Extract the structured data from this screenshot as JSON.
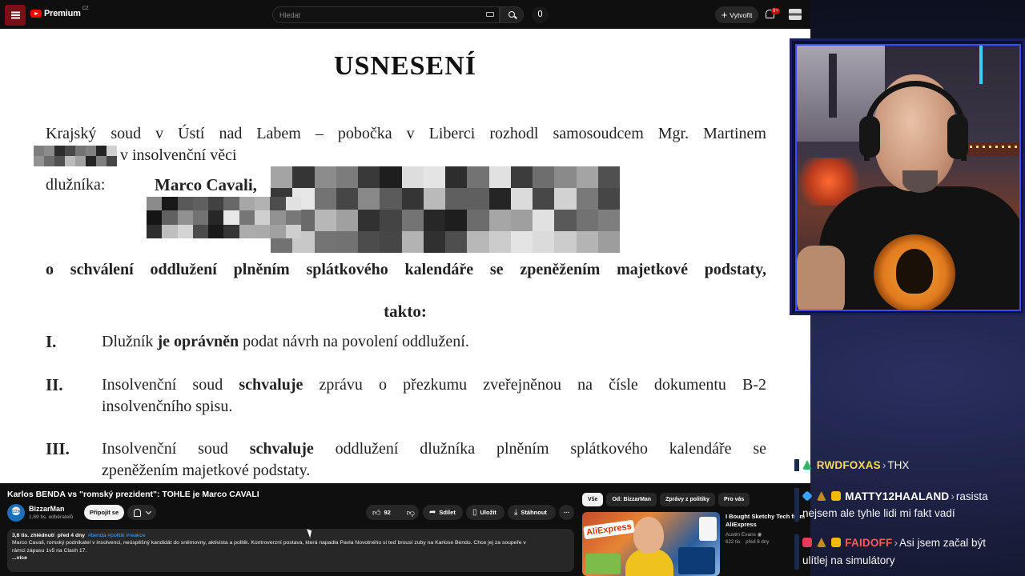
{
  "topbar": {
    "logo_text": "Premium",
    "logo_country": "CZ",
    "search_placeholder": "Hledat",
    "create_label": "Vytvořit",
    "notification_count": "9+"
  },
  "document": {
    "title": "USNESENÍ",
    "intro_line1": "Krajský soud v Ústí nad Labem – pobočka v Liberci rozhodl samosoudcem Mgr. Martinem",
    "intro_line2": "v insolvenční věci",
    "debtor_label": "dlužníka:",
    "debtor_name": "Marco Cavali,",
    "bold_line": "o schválení oddlužení plněním splátkového kalendáře se zpeněžením majetkové podstaty,",
    "takto": "takto:",
    "items": [
      {
        "num": "I.",
        "pre": "Dlužník",
        "bold": "je oprávněn",
        "post": "podat návrh na povolení oddlužení."
      },
      {
        "num": "II.",
        "pre": "Insolvenční soud",
        "bold": "schvaluje",
        "post": "zprávu o přezkumu zveřejněnou na čísle dokumentu B-2",
        "line2": "insolvenčního spisu."
      },
      {
        "num": "III.",
        "pre": "Insolvenční soud",
        "bold": "schvaluje",
        "post": "oddlužení dlužníka plněním splátkového kalendáře se",
        "line2": "zpeněžením majetkové podstaty."
      }
    ]
  },
  "video": {
    "title": "Karlos BENDA vs \"romský prezident\": TOHLE je Marco CAVALI",
    "channel_name": "BizzarMan",
    "channel_avatar_text": "BIZZAR",
    "subscribers": "1,69 tis. odběratelů",
    "subscribe_label": "Připojit se",
    "like_count": "92",
    "share_label": "Sdílet",
    "save_label": "Uložit",
    "download_label": "Stáhnout",
    "more_label": "···"
  },
  "description": {
    "views": "3,6 tis. zhlédnutí",
    "date": "před 4 dny",
    "tags": "#benda #politik #reakce",
    "text_line1": "Marco Cavali, romský podnikatel v insolvenci, neúspěšný kandidát do sněmovny, aktivista a politik. Kontroverzní postava, která napadla Pavla Novotného si teď brousí zuby na Karlose Bendu. Chce jej za soupeře v",
    "text_line2": "rámci zápasu 1v5 na Clash 17.",
    "more": "...více"
  },
  "recommendations": {
    "chips": [
      "Vše",
      "Od: BizzarMan",
      "Zprávy z politiky",
      "Pro vás"
    ],
    "item": {
      "title_line1": "I Bought Sketchy Tech from",
      "title_line2": "AliExpress",
      "channel": "Austin Evans",
      "views": "622 tis.",
      "age": "před 8 dny",
      "thumb_text": "AliExpress"
    }
  },
  "chat": [
    {
      "user": "RWDFOXAS",
      "text": "THX"
    },
    {
      "user": "MATTY12HAALAND",
      "text": "rasista",
      "text2": "nejsem ale tyhle lidi mi fakt vadí"
    },
    {
      "user": "FAIDOFF",
      "text": "Asi jsem začal být",
      "text2": "ulítlej na simulátory"
    }
  ],
  "colors": {
    "yt_red": "#ff0000",
    "accent_blue": "#3ea6ff",
    "webcam_border": "#3a4cff"
  }
}
